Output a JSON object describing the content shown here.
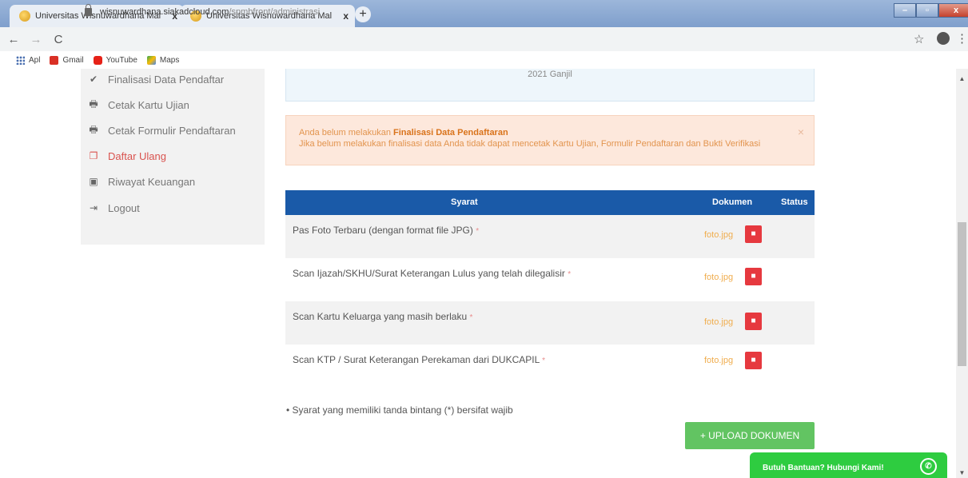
{
  "browser": {
    "tabs": [
      {
        "label": "Universitas Wisnuwardhana Mal",
        "close": "x"
      },
      {
        "label": "Universitas Wisnuwardhana Mal",
        "close": "x"
      }
    ],
    "new_tab": "+",
    "window_controls": {
      "minimize": "–",
      "maximize": "▫",
      "close": "x"
    },
    "nav": {
      "back": "←",
      "forward": "→",
      "reload": "C"
    },
    "url_host": "wisnuwardhana.siakadcloud.com",
    "url_path": "/spmbfront/administrasi",
    "star": "☆",
    "menu": "⋮",
    "bookmarks": [
      {
        "label": "Apl",
        "icon": "apps-icon"
      },
      {
        "label": "Gmail",
        "icon": "gmail-icon"
      },
      {
        "label": "YouTube",
        "icon": "youtube-icon"
      },
      {
        "label": "Maps",
        "icon": "maps-icon"
      }
    ]
  },
  "sidebar": {
    "items": [
      {
        "label": "Finalisasi Data Pendaftar",
        "icon": "check-icon",
        "glyph": "✔"
      },
      {
        "label": "Cetak Kartu Ujian",
        "icon": "print-icon",
        "glyph": "🖶"
      },
      {
        "label": "Cetak Formulir Pendaftaran",
        "icon": "print-icon",
        "glyph": "🖶"
      },
      {
        "label": "Daftar Ulang",
        "icon": "copy-icon",
        "glyph": "❐"
      },
      {
        "label": "Riwayat Keuangan",
        "icon": "money-icon",
        "glyph": "▣"
      },
      {
        "label": "Logout",
        "icon": "logout-icon",
        "glyph": "⇥"
      }
    ],
    "active_index": 3
  },
  "infobox": {
    "text": "2021 Ganjil"
  },
  "alert": {
    "prefix": "Anda belum melakukan ",
    "bold": "Finalisasi Data Pendaftaran",
    "line2": "Jika belum melakukan finalisasi data Anda tidak dapat mencetak Kartu Ujian, Formulir Pendaftaran dan Bukti Verifikasi",
    "close": "×"
  },
  "table": {
    "headers": {
      "syarat": "Syarat",
      "dokumen": "Dokumen",
      "status": "Status"
    },
    "rows": [
      {
        "syarat": "Pas Foto Terbaru (dengan format file JPG)",
        "required": "*",
        "file": "foto.jpg"
      },
      {
        "syarat": "Scan Ijazah/SKHU/Surat Keterangan Lulus yang telah dilegalisir",
        "required": "*",
        "file": "foto.jpg"
      },
      {
        "syarat": "Scan Kartu Keluarga yang masih berlaku",
        "required": "*",
        "file": "foto.jpg"
      },
      {
        "syarat": "Scan KTP / Surat Keterangan Perekaman dari DUKCAPIL",
        "required": "*",
        "file": "foto.jpg"
      }
    ]
  },
  "note": "Syarat yang memiliki tanda bintang (*) bersifat wajib",
  "upload_button": "+ UPLOAD DOKUMEN",
  "help": {
    "label": "Butuh Bantuan? Hubungi Kami!"
  },
  "colors": {
    "table_header": "#1a5aa8",
    "delete_button": "#e6393f",
    "upload_button": "#62c462",
    "alert_bg": "#fde8dc",
    "file_link": "#f0ad4e",
    "help_pill": "#2ecc40"
  }
}
